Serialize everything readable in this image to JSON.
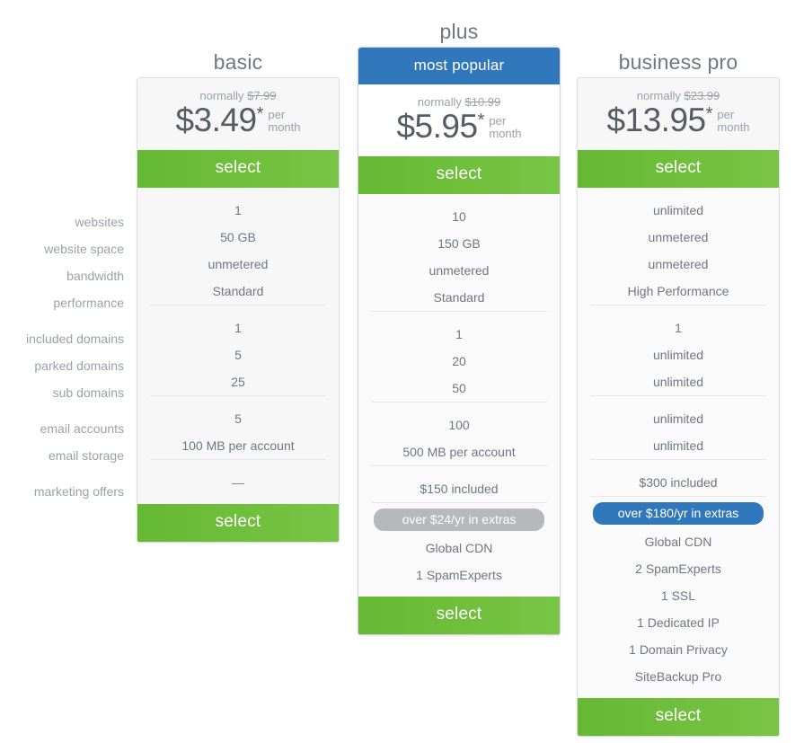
{
  "row_labels": [
    {
      "label": "websites"
    },
    {
      "label": "website space"
    },
    {
      "label": "bandwidth"
    },
    {
      "label": "performance"
    },
    {
      "label": "included domains"
    },
    {
      "label": "parked domains"
    },
    {
      "label": "sub domains"
    },
    {
      "label": "email accounts"
    },
    {
      "label": "email storage"
    },
    {
      "label": "marketing offers"
    }
  ],
  "plans": {
    "basic": {
      "title": "basic",
      "banner": null,
      "normally_prefix": "normally",
      "normally_price": "$7.99",
      "price": "$3.49",
      "star": "*",
      "per_line1": "per",
      "per_line2": "month",
      "select_top": "select",
      "select_bottom": "select",
      "group1": [
        "1",
        "50 GB",
        "unmetered",
        "Standard"
      ],
      "group2": [
        "1",
        "5",
        "25"
      ],
      "group3": [
        "5",
        "100 MB per account"
      ],
      "group4": [
        "—"
      ],
      "extras_badge": null,
      "extras": []
    },
    "plus": {
      "title": "plus",
      "banner": "most popular",
      "normally_prefix": "normally",
      "normally_price": "$10.99",
      "price": "$5.95",
      "star": "*",
      "per_line1": "per",
      "per_line2": "month",
      "select_top": "select",
      "select_bottom": "select",
      "group1": [
        "10",
        "150 GB",
        "unmetered",
        "Standard"
      ],
      "group2": [
        "1",
        "20",
        "50"
      ],
      "group3": [
        "100",
        "500 MB per account"
      ],
      "group4": [
        "$150 included"
      ],
      "extras_badge": "over $24/yr in extras",
      "extras_badge_color": "#b5b9bc",
      "extras": [
        "Global CDN",
        "1 SpamExperts"
      ]
    },
    "business": {
      "title": "business pro",
      "banner": null,
      "normally_prefix": "normally",
      "normally_price": "$23.99",
      "price": "$13.95",
      "star": "*",
      "per_line1": "per",
      "per_line2": "month",
      "select_top": "select",
      "select_bottom": "select",
      "group1": [
        "unlimited",
        "unmetered",
        "unmetered",
        "High Performance"
      ],
      "group2": [
        "1",
        "unlimited",
        "unlimited"
      ],
      "group3": [
        "unlimited",
        "unlimited"
      ],
      "group4": [
        "$300 included"
      ],
      "extras_badge": "over $180/yr in extras",
      "extras_badge_color": "#3077bc",
      "extras": [
        "Global CDN",
        "2 SpamExperts",
        "1 SSL",
        "1 Dedicated IP",
        "1 Domain Privacy",
        "SiteBackup Pro"
      ]
    }
  },
  "colors": {
    "green_button": "#6dbe3a",
    "blue_banner": "#3077bc",
    "gray_badge": "#b5b9bc",
    "text": "#6f7880",
    "muted": "#9aa1a8",
    "panel": "#f7f7f7"
  }
}
